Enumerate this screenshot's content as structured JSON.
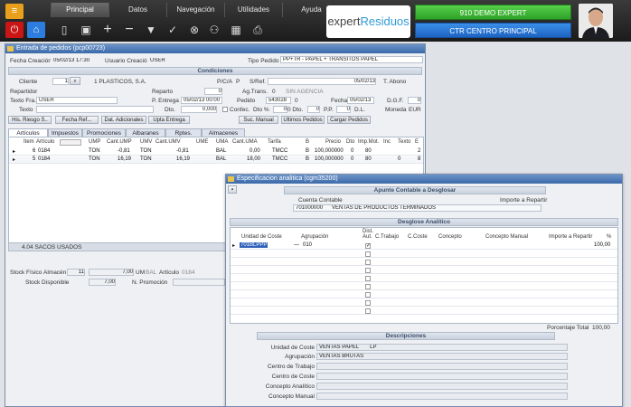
{
  "topbar": {
    "menu": [
      "Principal",
      "Datos",
      "Navegación",
      "Utilidades",
      "Ayuda"
    ],
    "logo_a": "expert",
    "logo_b": "Residuos",
    "company": "910 DEMO EXPERT",
    "center": "CTR CENTRO PRINCIPAL"
  },
  "pedidos": {
    "title": "Entrada de pedidos (pcp00723)",
    "fecha_label": "Fecha Creación",
    "fecha": "05/02/13 17:30",
    "usuario_label": "Usuario Creación",
    "usuario": "USER",
    "tipo_label": "Tipo Pedido",
    "tipo": "PP+TR - PAPEL + TRANSITOS PAPEL",
    "condiciones": "Condiciones",
    "cliente_label": "Cliente",
    "cliente_num": "1",
    "cliente_name": "1 PLASTICOS, S.A.",
    "pca_label": "P/C/A",
    "pca": "P",
    "sref_label": "S/Ref.",
    "sref_date": "05/02/13",
    "tabono": "T. Abono",
    "repartidor": "Repartidor",
    "reparto": "Reparto",
    "reparto_val": "0",
    "agtrans": "Ag.Trans.",
    "agtrans_num": "0",
    "agtrans_val": "SIN AGENCIA",
    "texto_fra": "Texto Fra.",
    "texto_fra_val": "USER",
    "pentrega": "P. Entrega",
    "pentrega_val": "05/02/13 00:00",
    "pedido": "Pedido",
    "pedido_num": "543028",
    "pedido_v": "0",
    "fecha2": "Fecha",
    "fecha2_val": "05/02/13",
    "dgf": "D.G.F.",
    "dgf_val": "0",
    "texto": "Texto",
    "dto": "Dto.",
    "dto_val": "0,000",
    "confec": "Confec.",
    "dtop": "Dto %",
    "dtop_val": "0",
    "dto2": "0 Dto.",
    "dto2_val": "0",
    "pp": "P.P.",
    "pp_val": "0",
    "dl": "D.L.",
    "moneda": "Moneda",
    "moneda_val": "EUR",
    "buttons": [
      "His. Riesgo S..",
      "Fecha Ref...",
      "Dat. Adicionales",
      "Upta Entrega",
      "Suc. Manual",
      "Ultimos Pedidos",
      "Cargar Pedidos"
    ],
    "tabs": [
      "Artículos",
      "Impuestos",
      "Promociones",
      "Albaranes",
      "Rptes.",
      "Almacenes"
    ],
    "cols": [
      "Item",
      "Artículo",
      "UMP",
      "Cant.UMP",
      "UMV",
      "Cant.UMV",
      "UME",
      "UMA",
      "Cant.UMA",
      "Tarifa",
      "B",
      "Precio",
      "Dto",
      "Imp.Mot.",
      "Inc",
      "Texto",
      "E"
    ],
    "rows": [
      [
        "6",
        "0184",
        "TON",
        "-0,81",
        "TON",
        "-0,81",
        "",
        "BAL",
        "0,00",
        "TMCC",
        "B",
        "100,000000",
        "0",
        "80",
        "",
        "",
        "2"
      ],
      [
        "5",
        "0184",
        "TON",
        "16,19",
        "TON",
        "16,19",
        "",
        "BAL",
        "18,00",
        "TMCC",
        "B",
        "100,000000",
        "0",
        "80",
        "0",
        "",
        "8"
      ]
    ],
    "status": "4.04 SACOS USADOS",
    "stock_label": "Stock Físico",
    "almacen_label": "Almacén",
    "almacen": "11",
    "stock_val": "7,00",
    "um_label": "UM",
    "um": "BAL",
    "art_label": "Artículo",
    "art": "0184",
    "disp_label": "Stock Disponible",
    "disp": "7,00",
    "promo_label": "N. Promoción"
  },
  "analitica": {
    "title": "Especificacion analitica (cgm35200)",
    "apunte": "Apunte Contable a Desglosar",
    "cuenta_label": "Cuenta Contable",
    "importe_label": "Importe a Repartir",
    "cuenta": "701000000",
    "cuenta_desc": "VENTAS DE PRODUCTOS TERMINADOS",
    "desglose": "Desglose Analitico",
    "cols": [
      "Unidad de Coste",
      "Agrupación",
      "Dist. Aut.",
      "C.Trabajo",
      "C.Coste",
      "Concepto",
      "Concepto Manual",
      "Importe a Repartir",
      "%"
    ],
    "row": {
      "unidad": "701BLPPP",
      "agrup": "010",
      "importe": "100,00"
    },
    "total_label": "Porcentaje Total",
    "total": "100,00",
    "descripciones": "Descripciones",
    "desc_labels": [
      "Unidad de Coste",
      "Agrupación",
      "Centro de Trabajo",
      "Centro de Coste",
      "Concepto Analítico",
      "Concepto Manual"
    ],
    "desc_vals": [
      "VENTAS PAPEL",
      "VENTAS BRUTAS",
      "",
      "",
      "",
      ""
    ],
    "desc_code": "LP"
  }
}
